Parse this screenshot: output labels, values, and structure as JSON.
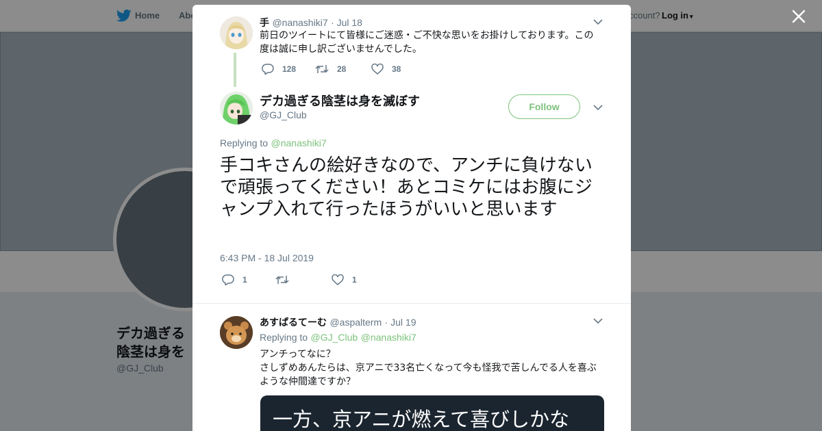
{
  "background": {
    "nav": {
      "home_label": "Home",
      "about_label": "Abo",
      "account_label": "ccount?",
      "login_label": "Log in"
    },
    "profile": {
      "name": "デカ過ぎる陰茎は身を滅ぼす",
      "handle": "@GJ_Club"
    }
  },
  "parent_tweet": {
    "name": "手",
    "handle": "@nanashiki7",
    "date": "· Jul 18",
    "text": "前日のツイートにて皆様にご迷惑・ご不快な思いをお掛けしております。この度は誠に申し訳ございませんでした。",
    "replies": "128",
    "retweets": "28",
    "likes": "38"
  },
  "main_tweet": {
    "name": "デカ過ぎる陰茎は身を滅ぼす",
    "handle": "@GJ_Club",
    "follow_label": "Follow",
    "replying_prefix": "Replying to",
    "replying_to": "@nanashiki7",
    "text": "手コキさんの絵好きなので、アンチに負けないで頑張ってください！あとコミケにはお腹にジャンプ入れて行ったほうがいいと思います",
    "timestamp": "6:43 PM - 18 Jul 2019",
    "replies": "1",
    "retweets": "",
    "likes": "1"
  },
  "reply_tweet": {
    "name": "あすぱるてーむ",
    "handle": "@aspalterm",
    "date": "· Jul 19",
    "replying_prefix": "Replying to",
    "replying_to_1": "@GJ_Club",
    "replying_to_2": "@nanashiki7",
    "text": "アンチってなに？\nさしずめあんたらは、京アニで33名亡くなって今も怪我で苦しんでる人を喜ぶような仲間達ですか？",
    "media_text": "一方、京アニが燃えて喜びしかな"
  },
  "colors": {
    "accent": "#7cc27b",
    "muted": "#657786",
    "text": "#14171a"
  }
}
